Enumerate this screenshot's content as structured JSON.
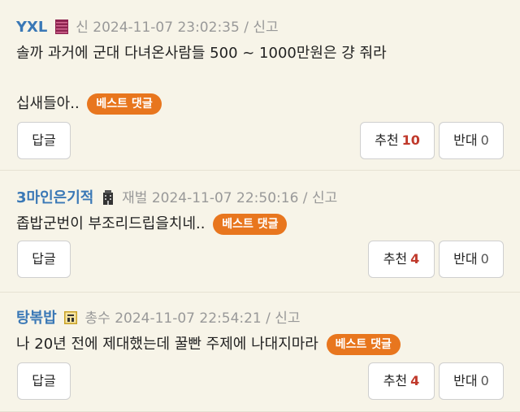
{
  "comments": [
    {
      "nick": "YXL",
      "level": "신",
      "date": "2024-11-07 23:02:35",
      "sep": "/",
      "report": "신고",
      "lines": [
        "솔까 과거에 군대 다녀온사람들 500 ~ 1000만원은 걍 줘라",
        "",
        "십새들아.."
      ],
      "best": "베스트 댓글",
      "reply": "답글",
      "up_label": "추천",
      "up_count": "10",
      "down_label": "반대",
      "down_count": "0"
    },
    {
      "nick": "3마인은기적",
      "level": "재벌",
      "date": "2024-11-07 22:50:16",
      "sep": "/",
      "report": "신고",
      "lines": [
        "좁밥군번이 부조리드립을치네.."
      ],
      "best": "베스트 댓글",
      "reply": "답글",
      "up_label": "추천",
      "up_count": "4",
      "down_label": "반대",
      "down_count": "0"
    },
    {
      "nick": "탕볶밥",
      "level": "총수",
      "date": "2024-11-07 22:54:21",
      "sep": "/",
      "report": "신고",
      "lines": [
        "나 20년 전에 제대했는데 꿀빤 주제에 나대지마라"
      ],
      "best": "베스트 댓글",
      "reply": "답글",
      "up_label": "추천",
      "up_count": "4",
      "down_label": "반대",
      "down_count": "0"
    }
  ],
  "colors": {
    "nick": "#3a78b6",
    "best_badge": "#e8761e",
    "up_count": "#c0392b",
    "bg": "#f7f4e8"
  },
  "icons": [
    "level-shin-icon",
    "level-jaebeol-icon",
    "level-chongsu-icon"
  ]
}
